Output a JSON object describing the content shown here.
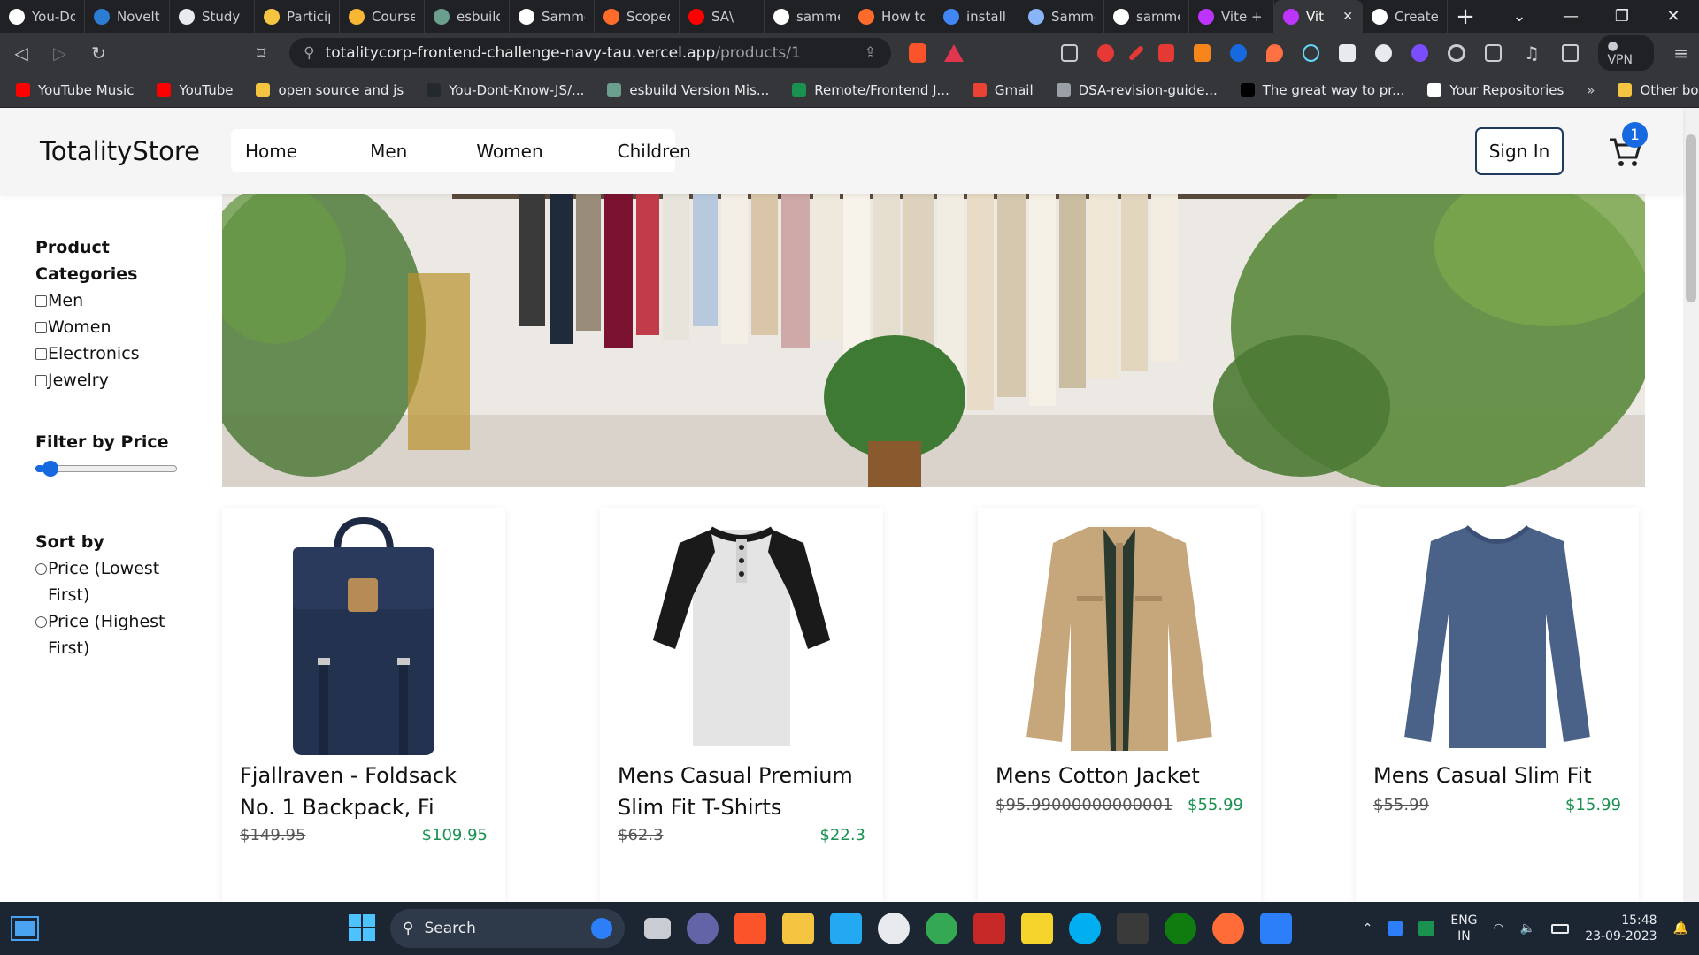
{
  "browser": {
    "tabs": [
      {
        "label": "You-Do",
        "color": "#ffffff"
      },
      {
        "label": "Novelt",
        "color": "#2b7cd3"
      },
      {
        "label": "Study p",
        "color": "#e8eaed"
      },
      {
        "label": "Particip",
        "color": "#f5c542"
      },
      {
        "label": "Course",
        "color": "#f7b733"
      },
      {
        "label": "esbuild",
        "color": "#6b9e8c"
      },
      {
        "label": "Samme",
        "color": "#ffffff"
      },
      {
        "label": "Scoped",
        "color": "#ff6b2b"
      },
      {
        "label": "SA\\",
        "color": "#ff0000"
      },
      {
        "label": "samme",
        "color": "#ffffff"
      },
      {
        "label": "How to",
        "color": "#ff6b2b"
      },
      {
        "label": "install",
        "color": "#4285f4"
      },
      {
        "label": "Samme",
        "color": "#8ab4f8"
      },
      {
        "label": "samme",
        "color": "#ffffff"
      },
      {
        "label": "Vite +",
        "color": "#bd34fe"
      },
      {
        "label": "Vit",
        "color": "#bd34fe"
      },
      {
        "label": "Create",
        "color": "#ffffff"
      }
    ],
    "active_tab_index": 15,
    "url_host": "totalitycorp-frontend-challenge-navy-tau.vercel.app",
    "url_path": "/products/1",
    "vpn_label": "VPN",
    "bookmarks": [
      {
        "label": "YouTube Music",
        "color": "#ff0000"
      },
      {
        "label": "YouTube",
        "color": "#ff0000"
      },
      {
        "label": "open source and js",
        "color": "#f5c542"
      },
      {
        "label": "You-Dont-Know-JS/...",
        "color": "#24292e"
      },
      {
        "label": "esbuild Version Mis...",
        "color": "#6b9e8c"
      },
      {
        "label": "Remote/Frontend J...",
        "color": "#1a9150"
      },
      {
        "label": "Gmail",
        "color": "#ea4335"
      },
      {
        "label": "DSA-revision-guide...",
        "color": "#9aa0a6"
      },
      {
        "label": "The great way to pr...",
        "color": "#000000"
      },
      {
        "label": "Your Repositories",
        "color": "#ffffff"
      }
    ],
    "bookmarks_more": "»",
    "other_bookmarks": "Other bookmarks"
  },
  "site": {
    "logo": "TotalityStore",
    "nav": [
      "Home",
      "Men",
      "Women",
      "Children"
    ],
    "sign_in": "Sign In",
    "cart_count": "1",
    "accent_color": "#1769e0"
  },
  "sidebar": {
    "categories_title": "Product Categories",
    "categories": [
      "Men",
      "Women",
      "Electronics",
      "Jewelry"
    ],
    "price_title": "Filter by Price",
    "price_slider_fraction": 0.05,
    "sort_title": "Sort by",
    "sort_options": [
      "Price (Lowest First)",
      "Price (Highest First)"
    ]
  },
  "products": [
    {
      "title": "Fjallraven - Foldsack No. 1 Backpack, Fi",
      "old_price": "$149.95",
      "new_price": "$109.95",
      "image": "backpack-image"
    },
    {
      "title": "Mens Casual Premium Slim Fit T-Shirts",
      "old_price": "$62.3",
      "new_price": "$22.3",
      "image": "raglan-tshirt-image"
    },
    {
      "title": "Mens Cotton Jacket",
      "old_price": "$95.99000000000001",
      "new_price": "$55.99",
      "image": "cotton-jacket-image"
    },
    {
      "title": "Mens Casual Slim Fit",
      "old_price": "$55.99",
      "new_price": "$15.99",
      "image": "slim-fit-shirt-image"
    }
  ],
  "taskbar": {
    "search_placeholder": "Search",
    "language": "ENG",
    "region": "IN",
    "time": "15:48",
    "date": "23-09-2023"
  }
}
